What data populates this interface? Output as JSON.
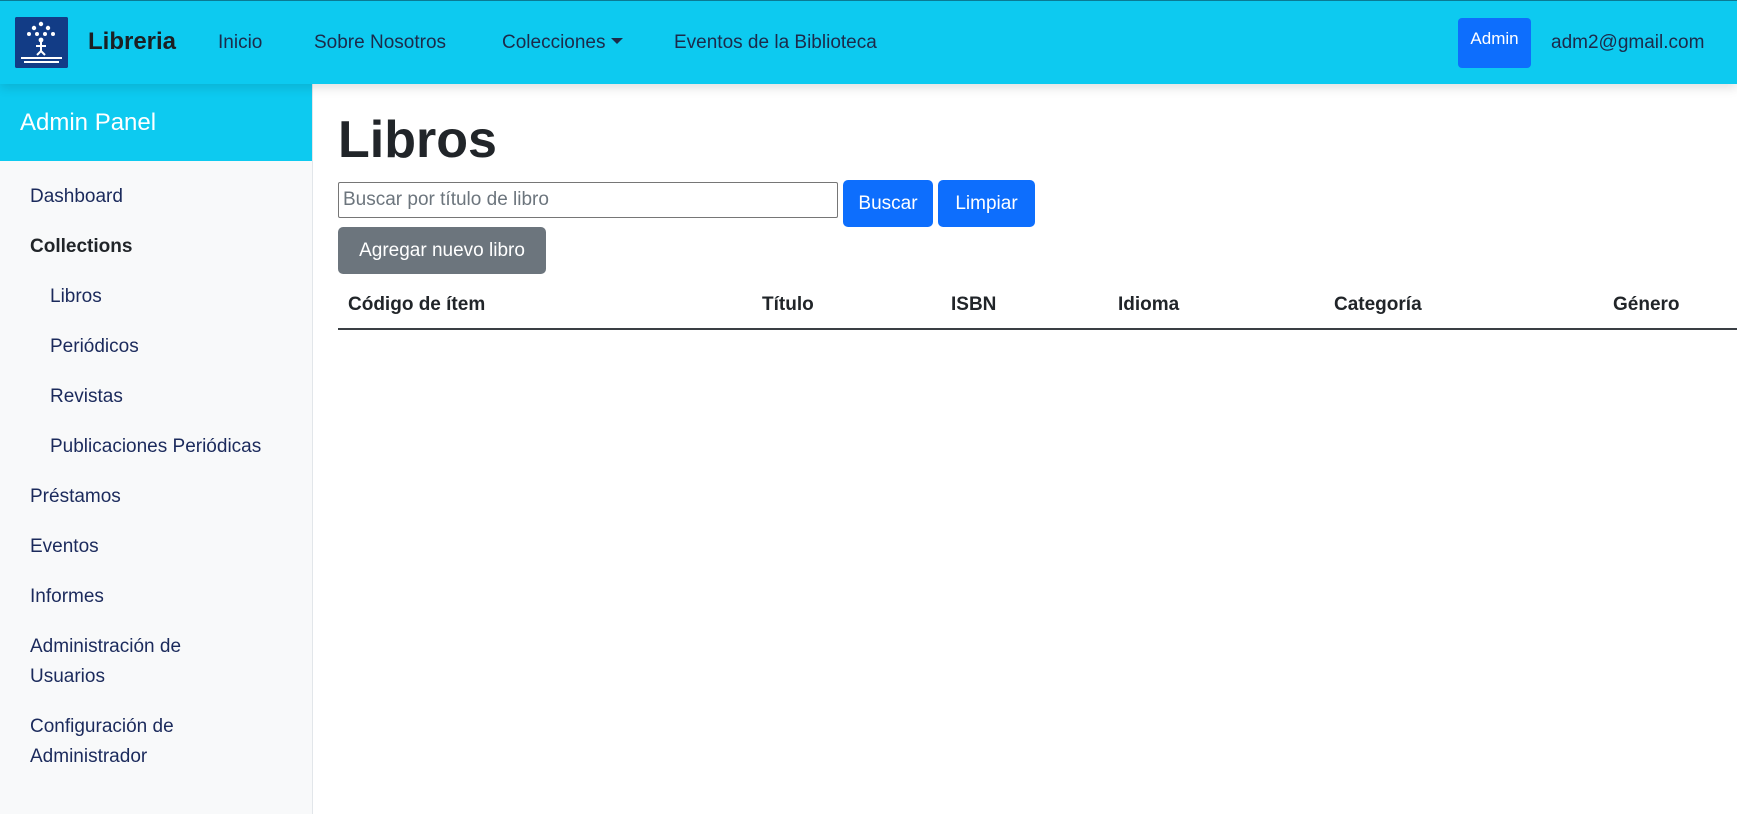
{
  "navbar": {
    "brand": "Libreria",
    "links": [
      "Inicio",
      "Sobre Nosotros",
      "Colecciones",
      "Eventos de la Biblioteca"
    ],
    "admin_label": "Admin",
    "user_email": "adm2@gmail.com"
  },
  "sidebar": {
    "title": "Admin Panel",
    "items": [
      "Dashboard",
      "Collections",
      "Libros",
      "Periódicos",
      "Revistas",
      "Publicaciones Periódicas",
      "Préstamos",
      "Eventos",
      "Informes",
      "Administración de Usuarios",
      "Configuración de Administrador"
    ]
  },
  "main": {
    "title": "Libros",
    "search_placeholder": "Buscar por título de libro",
    "search_value": "",
    "search_button": "Buscar",
    "clear_button": "Limpiar",
    "add_button": "Agregar nuevo libro",
    "table_headers": [
      "Código de ítem",
      "Título",
      "ISBN",
      "Idioma",
      "Categoría",
      "Género"
    ]
  },
  "colors": {
    "navbar": "#0dcaf0",
    "primary": "#0d6efd",
    "secondary": "#6c757d"
  }
}
